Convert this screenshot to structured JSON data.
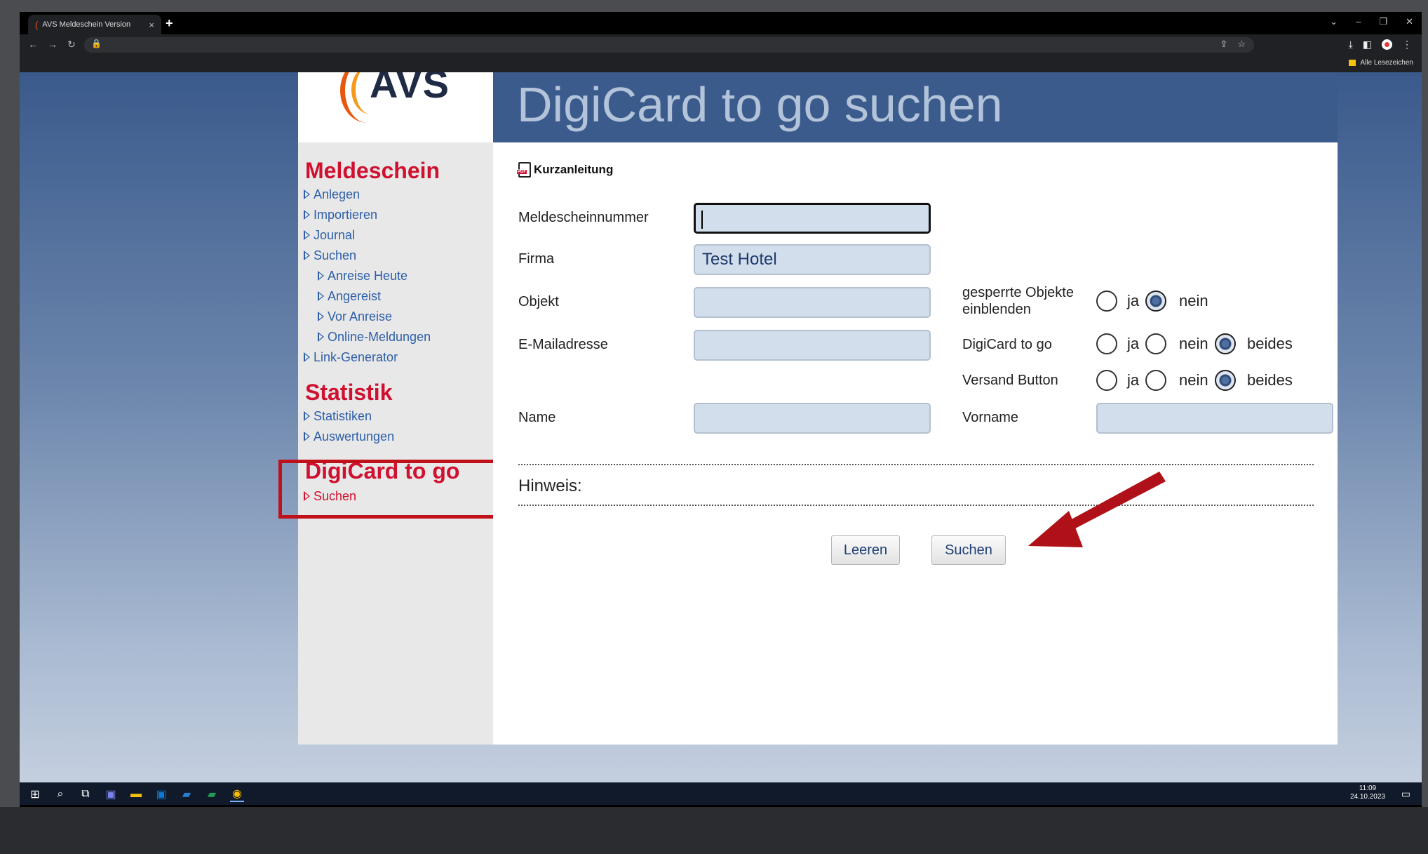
{
  "browser": {
    "tab_title": "AVS Meldeschein Version",
    "tab_close": "×",
    "new_tab": "+",
    "bookmarks_label": "Alle Lesezeichen"
  },
  "logo": {
    "text": "AVS"
  },
  "header": {
    "title": "DigiCard to go suchen"
  },
  "sidebar": {
    "sections": [
      {
        "title": "Meldeschein",
        "links": [
          "Anlegen",
          "Importieren",
          "Journal",
          "Suchen",
          "Anreise Heute",
          "Angereist",
          "Vor Anreise",
          "Online-Meldungen",
          "Link-Generator"
        ]
      },
      {
        "title": "Statistik",
        "links": [
          "Statistiken",
          "Auswertungen"
        ]
      },
      {
        "title": "DigiCard to go",
        "links": [
          "Suchen"
        ]
      }
    ]
  },
  "form": {
    "guide_label": "Kurzanleitung",
    "meldescheinnummer": {
      "label": "Meldescheinnummer",
      "value": ""
    },
    "firma": {
      "label": "Firma",
      "value": "Test Hotel"
    },
    "objekt": {
      "label": "Objekt",
      "value": ""
    },
    "email": {
      "label": "E-Mailadresse",
      "value": ""
    },
    "name": {
      "label": "Name",
      "value": ""
    },
    "vorname": {
      "label": "Vorname",
      "value": ""
    },
    "gesperrte": {
      "label_line1": "gesperrte Objekte",
      "label_line2": "einblenden",
      "options": [
        "ja",
        "nein"
      ],
      "selected": "nein"
    },
    "digicard": {
      "label": "DigiCard to go",
      "options": [
        "ja",
        "nein",
        "beides"
      ],
      "selected": "beides"
    },
    "versand": {
      "label": "Versand Button",
      "options": [
        "ja",
        "nein",
        "beides"
      ],
      "selected": "beides"
    },
    "hinweis": "Hinweis:",
    "buttons": {
      "clear": "Leeren",
      "search": "Suchen"
    }
  },
  "taskbar": {
    "time": "11:09",
    "date": "24.10.2023"
  },
  "colors": {
    "accent_red": "#d0102f",
    "link_blue": "#2d5ea8",
    "header_blue": "#3b5b8c"
  }
}
